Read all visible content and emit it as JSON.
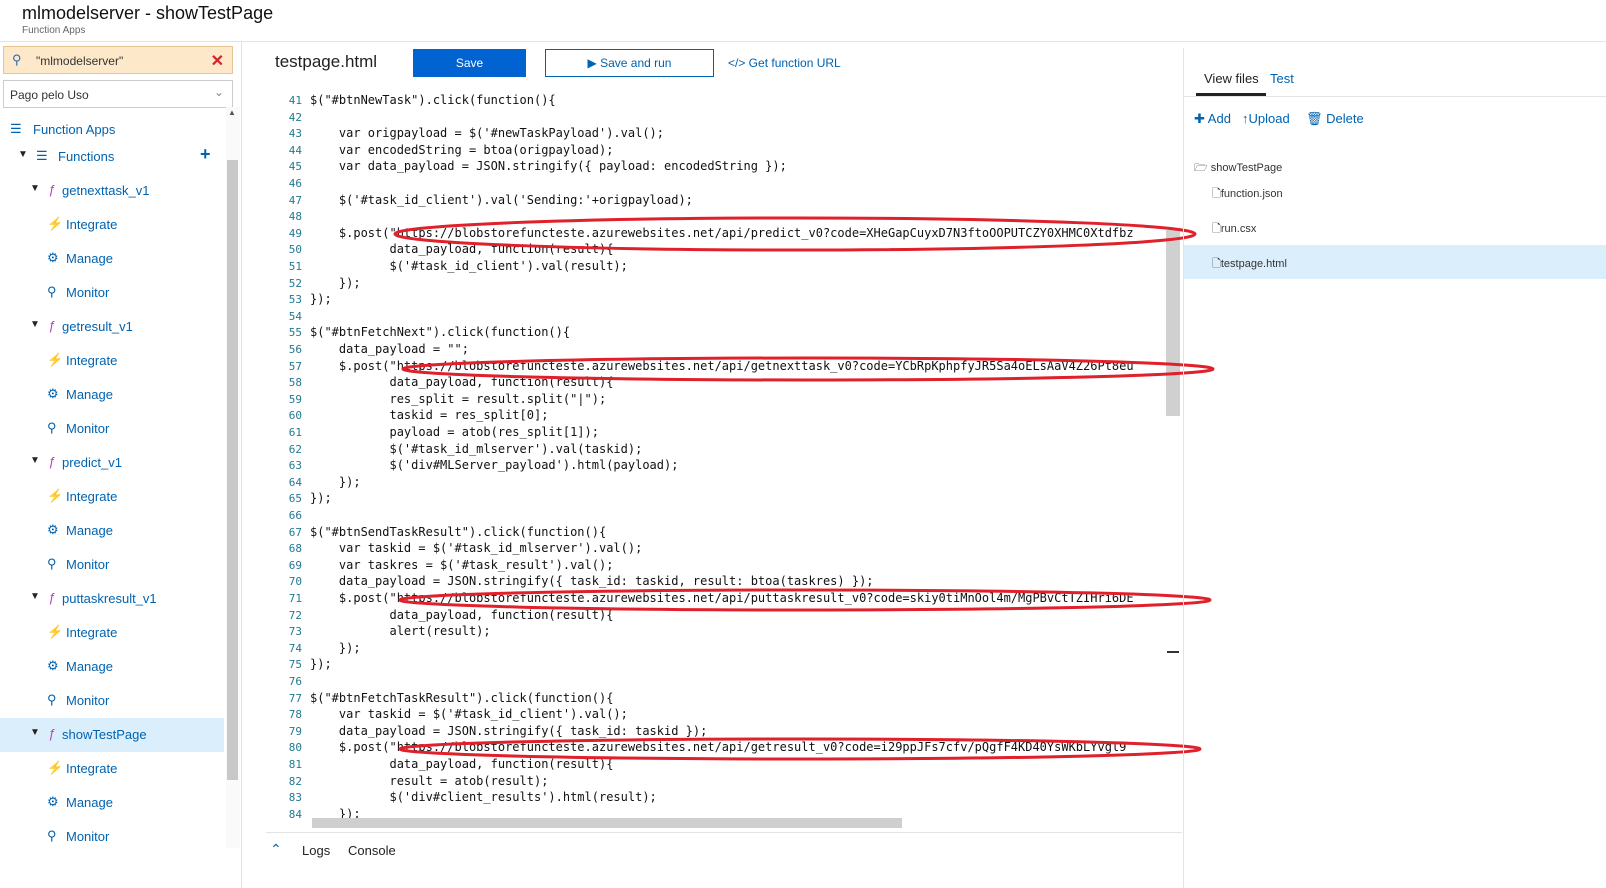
{
  "header": {
    "title": "mlmodelserver - showTestPage",
    "subtitle": "Function Apps"
  },
  "sidebar": {
    "search_value": "\"mlmodelserver\"",
    "subscription": "Pago pelo Uso",
    "function_apps_label": "Function Apps",
    "functions_label": "Functions",
    "functions": [
      {
        "name": "getnexttask_v1",
        "children": [
          "Integrate",
          "Manage",
          "Monitor"
        ]
      },
      {
        "name": "getresult_v1",
        "children": [
          "Integrate",
          "Manage",
          "Monitor"
        ]
      },
      {
        "name": "predict_v1",
        "children": [
          "Integrate",
          "Manage",
          "Monitor"
        ]
      },
      {
        "name": "puttaskresult_v1",
        "children": [
          "Integrate",
          "Manage",
          "Monitor"
        ]
      },
      {
        "name": "showTestPage",
        "children": [
          "Integrate",
          "Manage",
          "Monitor"
        ],
        "selected": true
      }
    ]
  },
  "editor": {
    "file_name": "testpage.html",
    "save_label": "Save",
    "save_run_label": "Save and run",
    "get_url_label": "</> Get function URL",
    "line_start": 41,
    "lines": [
      "$(\"#btnNewTask\").click(function(){",
      "",
      "    var origpayload = $('#newTaskPayload').val();",
      "    var encodedString = btoa(origpayload);",
      "    var data_payload = JSON.stringify({ payload: encodedString });",
      "",
      "    $('#task_id_client').val('Sending:'+origpayload);",
      "",
      "    $.post(\"https://blobstorefuncteste.azurewebsites.net/api/predict_v0?code=XHeGapCuyxD7N3ftoOOPUTCZY0XHMC0Xtdfbz",
      "           data_payload, function(result){",
      "           $('#task_id_client').val(result);",
      "    });",
      "});",
      "",
      "$(\"#btnFetchNext\").click(function(){",
      "    data_payload = \"\";",
      "    $.post(\"https://blobstorefuncteste.azurewebsites.net/api/getnexttask_v0?code=YCbRpKphpfyJR5Sa4oELsAaV4Z26Pt8eu",
      "           data_payload, function(result){",
      "           res_split = result.split(\"|\");",
      "           taskid = res_split[0];",
      "           payload = atob(res_split[1]);",
      "           $('#task_id_mlserver').val(taskid);",
      "           $('div#MLServer_payload').html(payload);",
      "    });",
      "});",
      "",
      "$(\"#btnSendTaskResult\").click(function(){",
      "    var taskid = $('#task_id_mlserver').val();",
      "    var taskres = $('#task_result').val();",
      "    data_payload = JSON.stringify({ task_id: taskid, result: btoa(taskres) });",
      "    $.post(\"https://blobstorefuncteste.azurewebsites.net/api/puttaskresult_v0?code=skiy0tiMnOol4m/MgPBvCtTZIHri6DE",
      "           data_payload, function(result){",
      "           alert(result);",
      "    });",
      "});",
      "",
      "$(\"#btnFetchTaskResult\").click(function(){",
      "    var taskid = $('#task_id_client').val();",
      "    data_payload = JSON.stringify({ task_id: taskid });",
      "    $.post(\"https://blobstorefuncteste.azurewebsites.net/api/getresult_v0?code=i29ppJFs7cfv/pQgfF4KD40YsWKbLYvgl9",
      "           data_payload, function(result){",
      "           result = atob(result);",
      "           $('div#client_results').html(result);",
      "    });"
    ]
  },
  "bottom": {
    "logs_label": "Logs",
    "console_label": "Console"
  },
  "right_panel": {
    "tabs": [
      "View files",
      "Test"
    ],
    "actions": [
      "Add",
      "Upload",
      "Delete"
    ],
    "folder": "showTestPage",
    "files": [
      "function.json",
      "run.csx",
      "testpage.html"
    ],
    "selected_file": "testpage.html"
  },
  "colors": {
    "accent": "#0063d1",
    "selection": "#dbeefc",
    "annotation": "#e0202a",
    "search_bg": "#fde8c9"
  }
}
